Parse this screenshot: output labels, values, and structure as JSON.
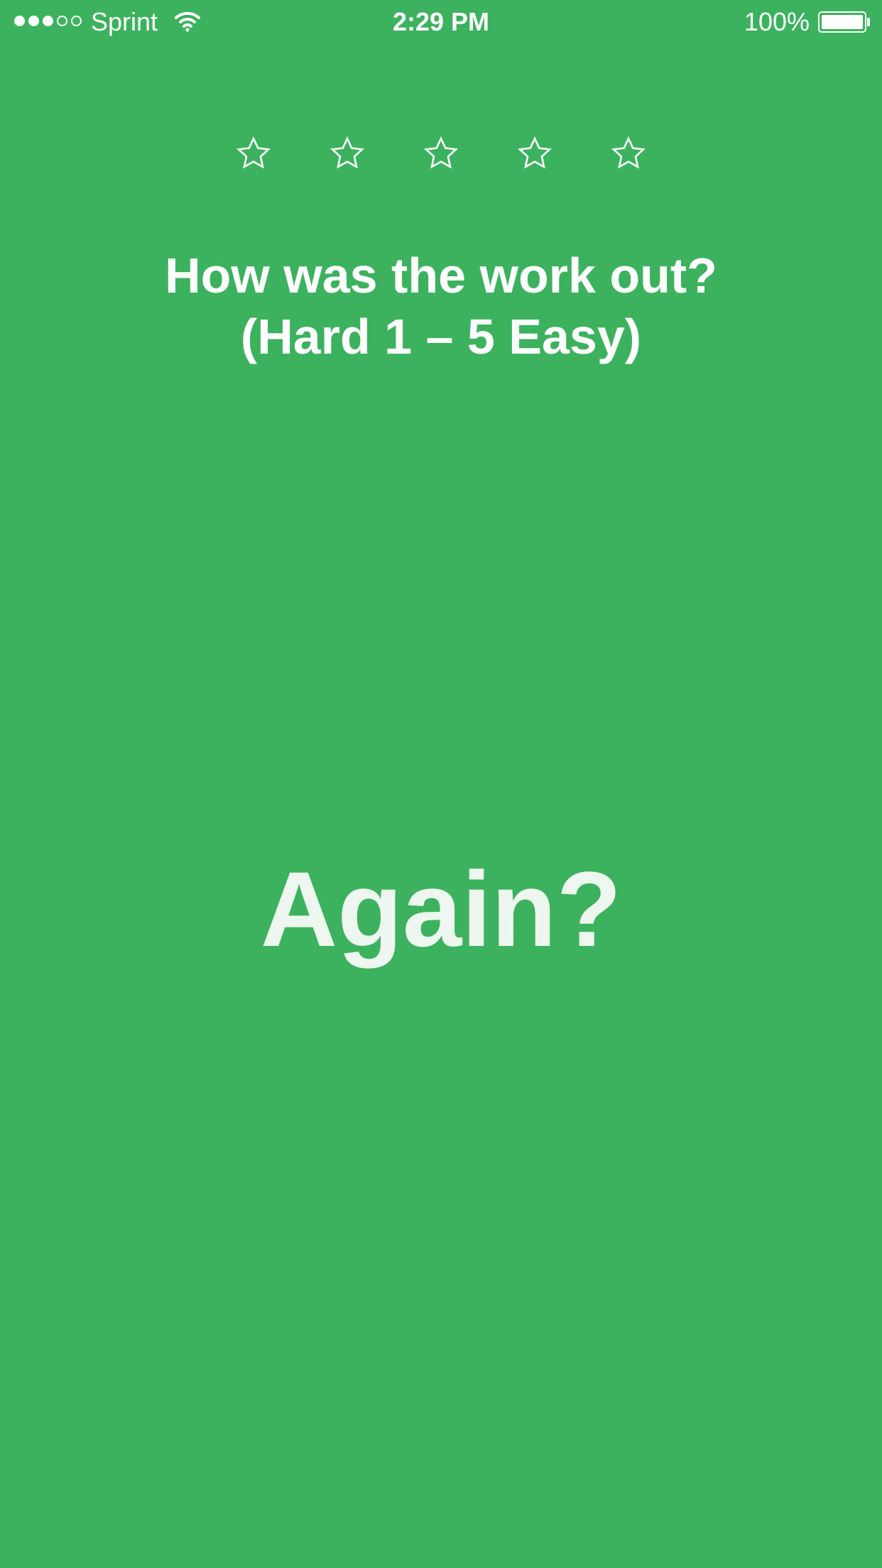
{
  "status_bar": {
    "signal_bars_filled": 3,
    "signal_bars_total": 5,
    "carrier": "Sprint",
    "wifi_icon": "wifi-icon",
    "time": "2:29 PM",
    "battery_percent": "100%",
    "battery_level": 1.0
  },
  "rating": {
    "stars_total": 5,
    "stars_selected": 0,
    "star_icon": "star-outline-icon"
  },
  "question": {
    "line1": "How was the work out?",
    "line2": "(Hard 1 – 5 Easy)"
  },
  "again_button": {
    "label": "Again?"
  },
  "colors": {
    "background": "#3db25e",
    "text": "#ffffff",
    "again_text": "#eef6f0"
  }
}
